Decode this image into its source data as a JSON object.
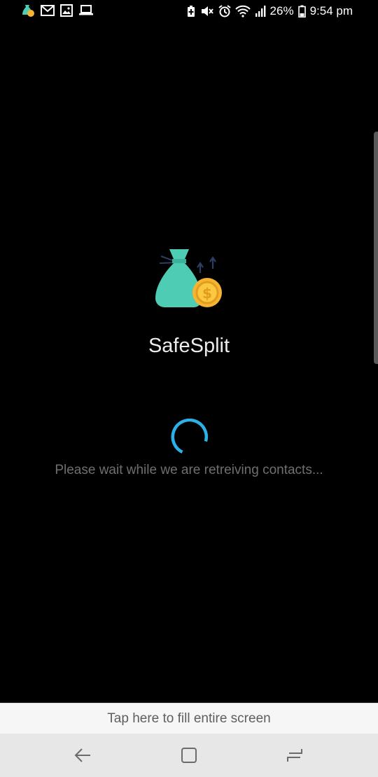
{
  "status_bar": {
    "battery_percent": "26%",
    "time": "9:54 pm",
    "left_icons": [
      "app-notification-icon",
      "gmail-icon",
      "image-icon",
      "laptop-icon"
    ],
    "right_icons": [
      "battery-saver-icon",
      "mute-icon",
      "alarm-icon",
      "wifi-icon",
      "signal-icon",
      "battery-icon"
    ]
  },
  "splash": {
    "app_name": "SafeSplit",
    "logo_icon": "money-bag-coin-icon",
    "loading_message": "Please wait while we are retreiving contacts..."
  },
  "banner": {
    "text": "Tap here to fill entire screen"
  },
  "navigation": {
    "buttons": [
      "back-icon",
      "home-icon",
      "recents-icon"
    ]
  },
  "colors": {
    "background": "#000000",
    "spinner": "#2ab1e8",
    "bag": "#4ecdb4",
    "coin": "#f5b431",
    "arrows": "#2c3e66"
  }
}
